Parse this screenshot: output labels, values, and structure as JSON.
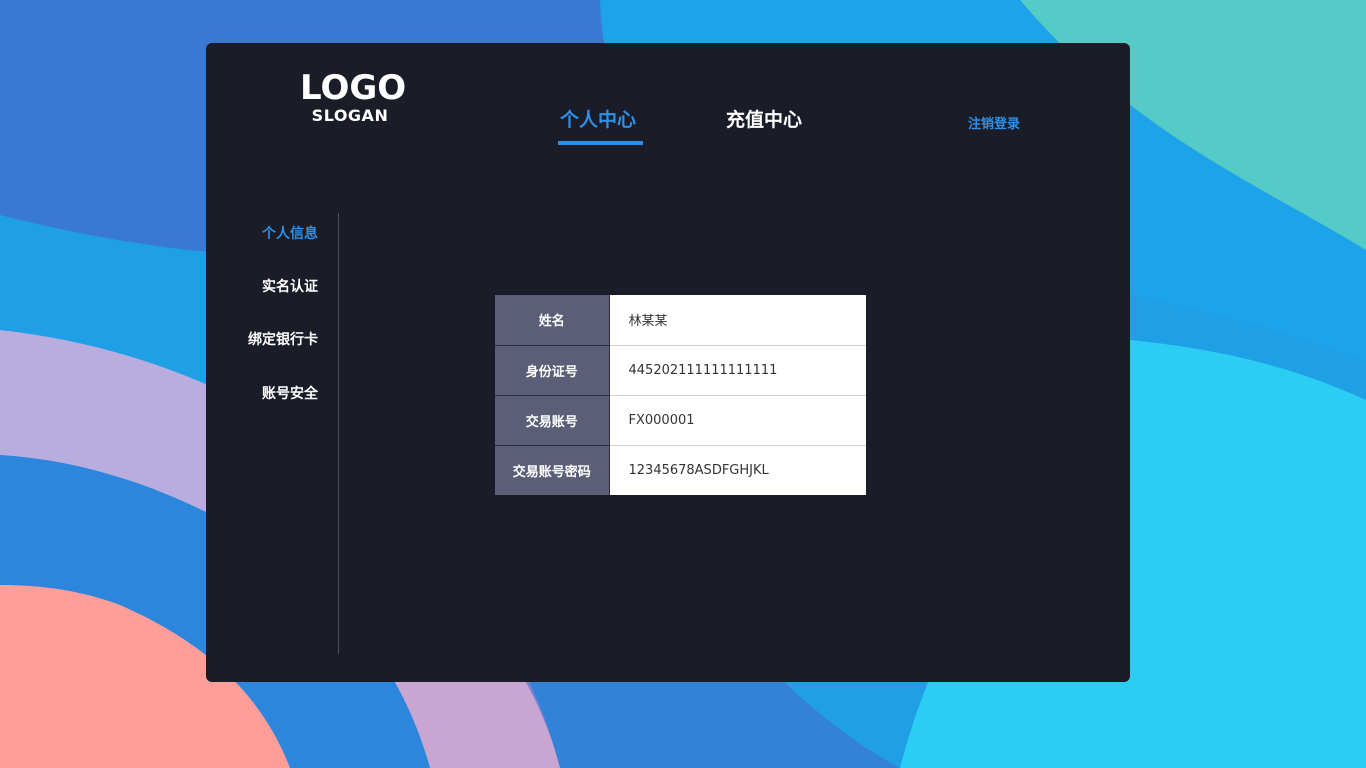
{
  "logo": {
    "main": "LOGO",
    "slogan": "SLOGAN"
  },
  "nav": {
    "tabs": [
      {
        "label": "个人中心",
        "active": true
      },
      {
        "label": "充值中心",
        "active": false
      }
    ],
    "logout_label": "注销登录"
  },
  "sidebar": {
    "items": [
      {
        "label": "个人信息",
        "active": true
      },
      {
        "label": "实名认证",
        "active": false
      },
      {
        "label": "绑定银行卡",
        "active": false
      },
      {
        "label": "账号安全",
        "active": false
      }
    ]
  },
  "info_table": {
    "rows": [
      {
        "key": "姓名",
        "value": "林某某"
      },
      {
        "key": "身份证号",
        "value": "445202111111111111"
      },
      {
        "key": "交易账号",
        "value": "FX000001"
      },
      {
        "key": "交易账号密码",
        "value": "12345678ASDFGHJKL"
      }
    ]
  },
  "colors": {
    "panel_bg": "#1a1c27",
    "accent": "#2f8fe6",
    "table_key_bg": "#5b5e77",
    "table_value_bg": "#ffffff"
  }
}
